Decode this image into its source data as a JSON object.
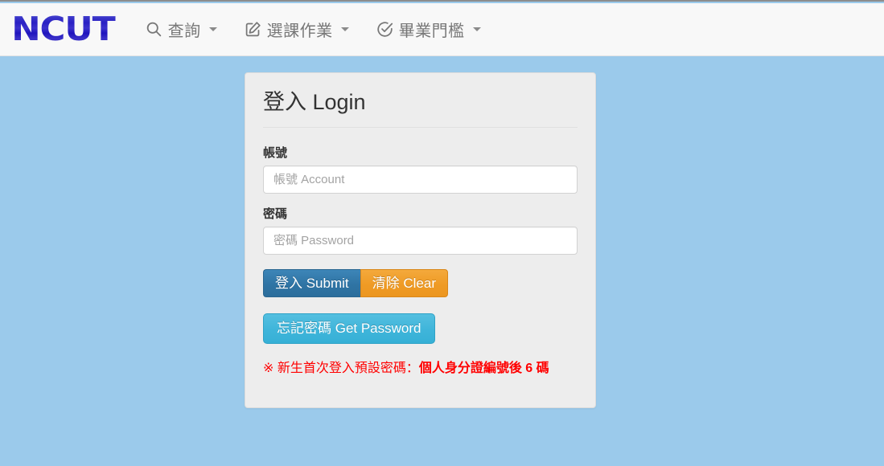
{
  "navbar": {
    "brand": "NCUT",
    "items": [
      {
        "icon": "search-icon",
        "label": "查詢",
        "has_caret": true
      },
      {
        "icon": "edit-square-icon",
        "label": "選課作業",
        "has_caret": true
      },
      {
        "icon": "check-circle-icon",
        "label": "畢業門檻",
        "has_caret": true
      }
    ]
  },
  "login_card": {
    "title": "登入 Login",
    "account": {
      "label": "帳號",
      "placeholder": "帳號 Account",
      "value": ""
    },
    "password": {
      "label": "密碼",
      "placeholder": "密碼 Password",
      "value": ""
    },
    "buttons": {
      "submit": "登入 Submit",
      "clear": "清除 Clear",
      "get_password": "忘記密碼 Get Password"
    },
    "notice": {
      "text": "※ 新生首次登入預設密碼：",
      "highlight": "個人身分證編號後 6 碼"
    }
  },
  "colors": {
    "page_background": "#9bcaeb",
    "navbar_background": "#f8f8f8",
    "card_background": "#ededed",
    "brand": "#2a20c4",
    "primary_button": "#2f74a4",
    "warning_button": "#ef9b25",
    "info_button": "#3fb5da",
    "notice_text": "#ff0000"
  }
}
